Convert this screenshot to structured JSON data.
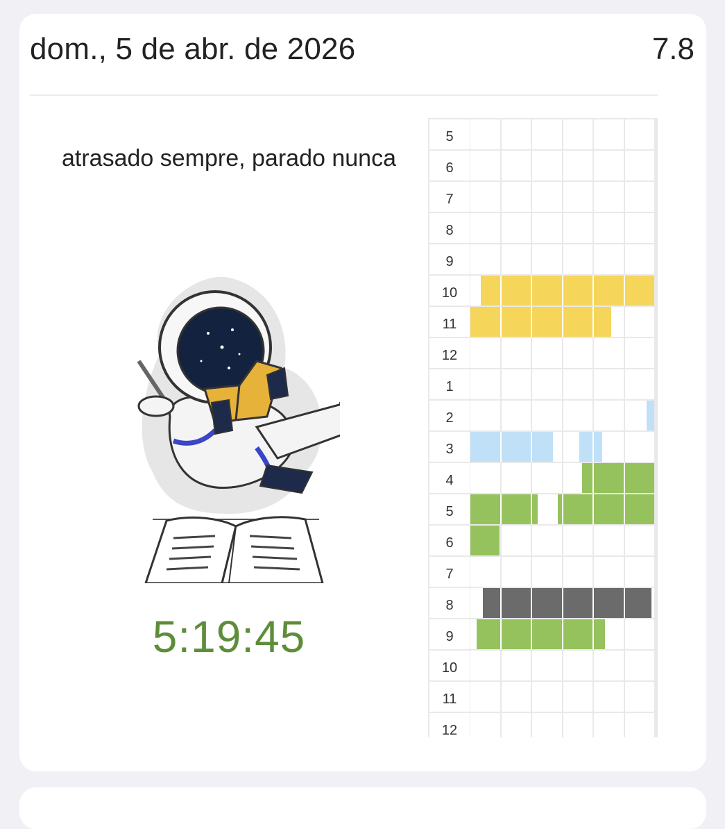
{
  "header": {
    "date": "dom., 5 de abr. de 2026",
    "score": "7.8"
  },
  "quote": "atrasado sempre, parado nunca",
  "illustration": {
    "name": "astronaut-reading-book-illustration"
  },
  "timer": {
    "value": "5:19:45",
    "color": "#5e8d3a"
  },
  "schedule": {
    "hour_labels": [
      "5",
      "6",
      "7",
      "8",
      "9",
      "10",
      "11",
      "12",
      "1",
      "2",
      "3",
      "4",
      "5",
      "6",
      "7",
      "8",
      "9",
      "10",
      "11",
      "12"
    ],
    "columns_per_hour": 6,
    "category_colors": {
      "yellow": "#f5d55a",
      "light-blue": "#bfe0f6",
      "green": "#96c25e",
      "gray": "#6b6b6b"
    },
    "blocks": [
      {
        "row": 5,
        "start": 0.35,
        "end": 6.0,
        "color": "yellow"
      },
      {
        "row": 6,
        "start": 0.0,
        "end": 4.6,
        "color": "yellow"
      },
      {
        "row": 9,
        "start": 5.75,
        "end": 6.0,
        "color": "light-blue"
      },
      {
        "row": 10,
        "start": 0.0,
        "end": 2.7,
        "color": "light-blue"
      },
      {
        "row": 10,
        "start": 3.55,
        "end": 4.3,
        "color": "light-blue"
      },
      {
        "row": 11,
        "start": 3.65,
        "end": 6.0,
        "color": "green"
      },
      {
        "row": 12,
        "start": 0.0,
        "end": 2.2,
        "color": "green"
      },
      {
        "row": 12,
        "start": 2.85,
        "end": 6.0,
        "color": "green"
      },
      {
        "row": 13,
        "start": 0.0,
        "end": 0.95,
        "color": "green"
      },
      {
        "row": 15,
        "start": 0.4,
        "end": 5.9,
        "color": "gray"
      },
      {
        "row": 16,
        "start": 0.2,
        "end": 4.4,
        "color": "green"
      }
    ]
  }
}
